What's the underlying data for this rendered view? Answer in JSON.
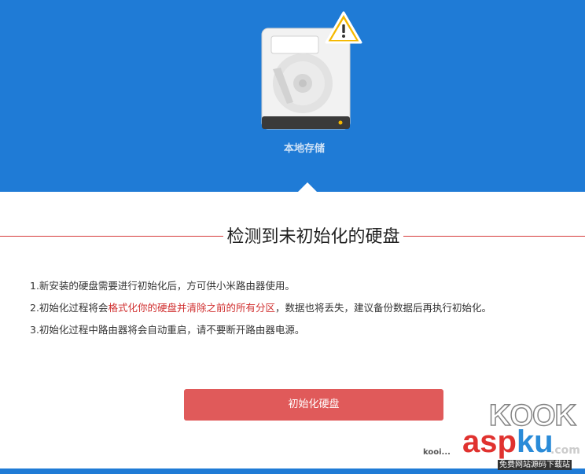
{
  "header": {
    "storage_label": "本地存储"
  },
  "main": {
    "title": "检测到未初始化的硬盘",
    "notes": [
      {
        "text": "1.新安装的硬盘需要进行初始化后，方可供小米路由器使用。"
      },
      {
        "pre": "2.初始化过程将会",
        "highlight": "格式化你的硬盘并清除之前的所有分区",
        "post": "，数据也将丢失，建议备份数据后再执行初始化。"
      },
      {
        "text": "3.初始化过程中路由器将会自动重启，请不要断开路由器电源。"
      }
    ],
    "button_label": "初始化硬盘"
  },
  "watermark": {
    "kook": "KOOK",
    "asp": "asp",
    "ku": "ku",
    "dotcom": ".com",
    "small": "kooi...",
    "sub": "免费网站源码下载站"
  },
  "colors": {
    "header_bg": "#1f7bd6",
    "highlight": "#d02f2f",
    "button_bg": "#e05a5a",
    "warning": "#f5b800"
  },
  "icons": {
    "disk": "hard-disk-icon",
    "warning": "warning-triangle-icon"
  }
}
